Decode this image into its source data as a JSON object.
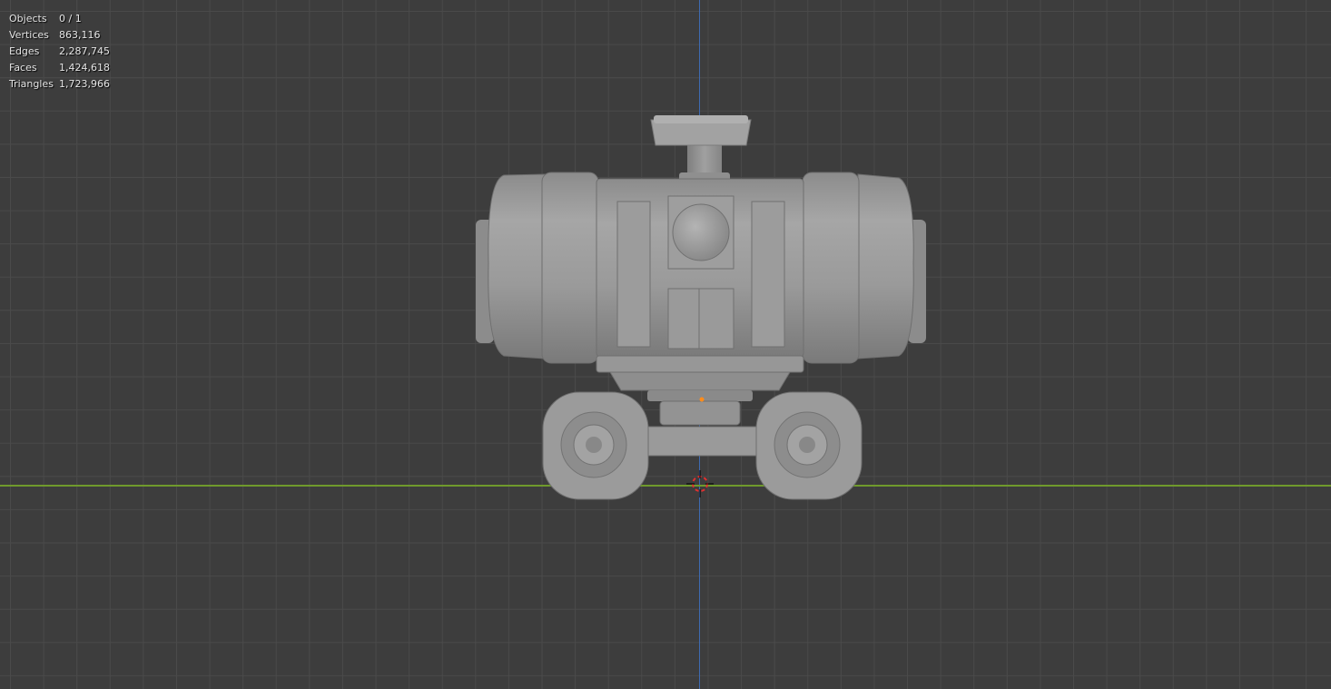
{
  "app": "Blender 3D Viewport",
  "stats": {
    "objects_label": "Objects",
    "objects_value": "0 / 1",
    "vertices_label": "Vertices",
    "vertices_value": "863,116",
    "edges_label": "Edges",
    "edges_value": "2,287,745",
    "faces_label": "Faces",
    "faces_value": "1,424,618",
    "triangles_label": "Triangles",
    "triangles_value": "1,723,966"
  },
  "colors": {
    "background": "#3d3d3d",
    "grid": "#4a4a4a",
    "axis_z": "#3e6ab0",
    "axis_x": "#6f9a2c",
    "model": "#9a9a9a",
    "origin": "#ff8c1a",
    "cursor": "#e03030"
  },
  "icons": {
    "cursor": "3d-cursor-icon",
    "origin": "object-origin-icon"
  }
}
